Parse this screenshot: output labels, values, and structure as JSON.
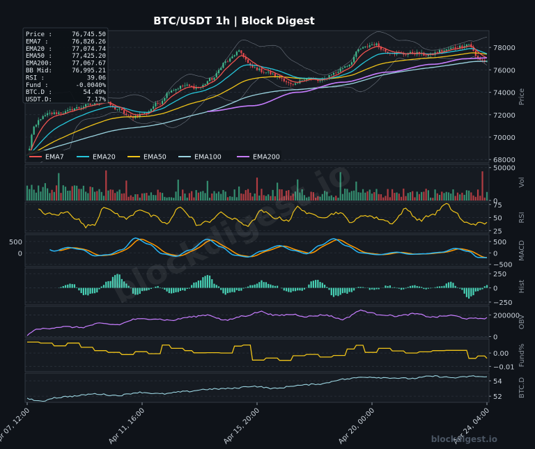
{
  "chart_data": {
    "type": "line",
    "title": "BTC/USDT  1h  |  Block Digest",
    "watermark": "blockdigest.io",
    "footer_brand": "blockdigest.io",
    "colors": {
      "background": "#0f1319",
      "panel": "#161b22",
      "grid": "#2a313b",
      "price_up": "#3fb68b",
      "price_down": "#e5484d",
      "ema7": "#ef5350",
      "ema20": "#26c6da",
      "ema50": "#f0c419",
      "ema100": "#9bd4e0",
      "ema200": "#c77dff",
      "rsi": "#f0c419",
      "macd": "#29b6f6",
      "signal": "#ff9800",
      "hist": "#48d1b5",
      "obv": "#c77dff",
      "funding": "#f0c419",
      "btcd": "#9bd4e0"
    },
    "x_ticks": [
      "Apr 07, 12:00",
      "Apr 11, 16:00",
      "Apr 15, 20:00",
      "Apr 20, 00:00",
      "Apr 24, 04:00"
    ],
    "info_box": [
      {
        "label": "Price  :",
        "value": "76,745.50"
      },
      {
        "label": "EMA7   :",
        "value": "76,826.26"
      },
      {
        "label": "EMA20  :",
        "value": "77,074.74"
      },
      {
        "label": "EMA50  :",
        "value": "77,425.20"
      },
      {
        "label": "EMA200:",
        "value": "77,067.67"
      },
      {
        "label": "BB Mid:",
        "value": "76,995.21"
      },
      {
        "label": "RSI    :",
        "value": "39.06"
      },
      {
        "label": "Fund   :",
        "value": "-0.0040%"
      },
      {
        "label": "BTC.D  :",
        "value": "54.49%"
      },
      {
        "label": "USDT.D:",
        "value": "7.17%"
      }
    ],
    "legend": [
      {
        "name": "EMA7",
        "color": "#ef5350"
      },
      {
        "name": "EMA20",
        "color": "#26c6da"
      },
      {
        "name": "EMA50",
        "color": "#f0c419"
      },
      {
        "name": "EMA100",
        "color": "#9bd4e0"
      },
      {
        "name": "EMA200",
        "color": "#c77dff"
      }
    ],
    "price_anchors": [
      [
        0,
        68400
      ],
      [
        3,
        70800
      ],
      [
        6,
        71700
      ],
      [
        10,
        72100
      ],
      [
        16,
        72200
      ],
      [
        22,
        72600
      ],
      [
        28,
        72900
      ],
      [
        34,
        73200
      ],
      [
        40,
        72500
      ],
      [
        46,
        71800
      ],
      [
        52,
        72100
      ],
      [
        58,
        73000
      ],
      [
        64,
        74200
      ],
      [
        70,
        74600
      ],
      [
        76,
        74400
      ],
      [
        82,
        75200
      ],
      [
        88,
        76700
      ],
      [
        94,
        77600
      ],
      [
        100,
        76200
      ],
      [
        106,
        75800
      ],
      [
        112,
        75300
      ],
      [
        118,
        74600
      ],
      [
        124,
        75300
      ],
      [
        130,
        75000
      ],
      [
        136,
        75700
      ],
      [
        142,
        76400
      ],
      [
        148,
        77900
      ],
      [
        154,
        78300
      ],
      [
        160,
        77600
      ],
      [
        166,
        77400
      ],
      [
        172,
        77500
      ],
      [
        178,
        77300
      ],
      [
        184,
        77700
      ],
      [
        190,
        78000
      ],
      [
        196,
        78300
      ],
      [
        200,
        77000
      ],
      [
        204,
        76750
      ]
    ],
    "ema200_anchors": [
      [
        80,
        72300
      ],
      [
        100,
        72800
      ],
      [
        120,
        74000
      ],
      [
        140,
        74900
      ],
      [
        160,
        75800
      ],
      [
        180,
        76500
      ],
      [
        195,
        77000
      ],
      [
        204,
        77070
      ]
    ],
    "rsi_anchors": [
      [
        0,
        74
      ],
      [
        4,
        66
      ],
      [
        8,
        58
      ],
      [
        12,
        55
      ],
      [
        18,
        60
      ],
      [
        22,
        48
      ],
      [
        26,
        33
      ],
      [
        30,
        38
      ],
      [
        34,
        72
      ],
      [
        38,
        60
      ],
      [
        44,
        48
      ],
      [
        50,
        66
      ],
      [
        56,
        52
      ],
      [
        62,
        38
      ],
      [
        68,
        72
      ],
      [
        72,
        52
      ],
      [
        76,
        35
      ],
      [
        80,
        42
      ],
      [
        86,
        58
      ],
      [
        92,
        46
      ],
      [
        98,
        35
      ],
      [
        104,
        62
      ],
      [
        110,
        50
      ],
      [
        116,
        45
      ],
      [
        120,
        70
      ],
      [
        126,
        55
      ],
      [
        132,
        52
      ],
      [
        138,
        60
      ],
      [
        144,
        42
      ],
      [
        150,
        55
      ],
      [
        156,
        48
      ],
      [
        162,
        40
      ],
      [
        168,
        66
      ],
      [
        174,
        45
      ],
      [
        180,
        56
      ],
      [
        186,
        75
      ],
      [
        190,
        60
      ],
      [
        194,
        40
      ],
      [
        198,
        38
      ],
      [
        204,
        39
      ]
    ],
    "macd_anchors": [
      [
        0,
        580
      ],
      [
        6,
        320
      ],
      [
        12,
        80
      ],
      [
        18,
        240
      ],
      [
        24,
        150
      ],
      [
        30,
        -130
      ],
      [
        36,
        -80
      ],
      [
        42,
        140
      ],
      [
        48,
        650
      ],
      [
        54,
        380
      ],
      [
        60,
        -40
      ],
      [
        66,
        -150
      ],
      [
        72,
        120
      ],
      [
        80,
        600
      ],
      [
        86,
        260
      ],
      [
        92,
        -100
      ],
      [
        98,
        -180
      ],
      [
        104,
        80
      ],
      [
        112,
        320
      ],
      [
        118,
        110
      ],
      [
        124,
        -40
      ],
      [
        130,
        330
      ],
      [
        136,
        620
      ],
      [
        142,
        300
      ],
      [
        148,
        0
      ],
      [
        156,
        -80
      ],
      [
        164,
        30
      ],
      [
        170,
        -60
      ],
      [
        176,
        -40
      ],
      [
        184,
        30
      ],
      [
        190,
        200
      ],
      [
        196,
        60
      ],
      [
        200,
        -200
      ],
      [
        204,
        -210
      ]
    ],
    "hist_anchors": [
      [
        0,
        0
      ],
      [
        4,
        -120
      ],
      [
        10,
        -60
      ],
      [
        16,
        30
      ],
      [
        20,
        70
      ],
      [
        26,
        -130
      ],
      [
        30,
        -80
      ],
      [
        36,
        110
      ],
      [
        40,
        260
      ],
      [
        44,
        80
      ],
      [
        48,
        -120
      ],
      [
        52,
        -60
      ],
      [
        58,
        30
      ],
      [
        64,
        -90
      ],
      [
        70,
        -40
      ],
      [
        76,
        120
      ],
      [
        80,
        240
      ],
      [
        84,
        40
      ],
      [
        88,
        -110
      ],
      [
        94,
        -50
      ],
      [
        100,
        40
      ],
      [
        104,
        120
      ],
      [
        110,
        40
      ],
      [
        116,
        -70
      ],
      [
        122,
        -40
      ],
      [
        128,
        150
      ],
      [
        132,
        60
      ],
      [
        136,
        -150
      ],
      [
        142,
        -90
      ],
      [
        148,
        20
      ],
      [
        154,
        -40
      ],
      [
        160,
        40
      ],
      [
        166,
        -30
      ],
      [
        172,
        40
      ],
      [
        178,
        -20
      ],
      [
        184,
        30
      ],
      [
        188,
        100
      ],
      [
        192,
        -20
      ],
      [
        196,
        -180
      ],
      [
        200,
        -60
      ],
      [
        204,
        40
      ]
    ],
    "obv_anchors": [
      [
        0,
        10000
      ],
      [
        3,
        60000
      ],
      [
        8,
        75000
      ],
      [
        16,
        90000
      ],
      [
        24,
        85000
      ],
      [
        32,
        120000
      ],
      [
        40,
        110000
      ],
      [
        48,
        160000
      ],
      [
        56,
        165000
      ],
      [
        64,
        150000
      ],
      [
        72,
        180000
      ],
      [
        80,
        200000
      ],
      [
        88,
        150000
      ],
      [
        96,
        190000
      ],
      [
        104,
        230000
      ],
      [
        110,
        195000
      ],
      [
        118,
        205000
      ],
      [
        124,
        185000
      ],
      [
        132,
        200000
      ],
      [
        140,
        160000
      ],
      [
        148,
        240000
      ],
      [
        156,
        205000
      ],
      [
        164,
        190000
      ],
      [
        172,
        210000
      ],
      [
        180,
        180000
      ],
      [
        188,
        195000
      ],
      [
        196,
        165000
      ],
      [
        204,
        170000
      ]
    ],
    "funding_steps": [
      [
        0,
        0.0082
      ],
      [
        6,
        0.0074
      ],
      [
        12,
        0.0054
      ],
      [
        18,
        0.0075
      ],
      [
        24,
        0.0043
      ],
      [
        30,
        0.0018
      ],
      [
        36,
        0.0005
      ],
      [
        42,
        -0.0011
      ],
      [
        48,
        0.001
      ],
      [
        54,
        -0.0005
      ],
      [
        60,
        0.006
      ],
      [
        64,
        0.0035
      ],
      [
        70,
        0.0018
      ],
      [
        74,
        0.0002
      ],
      [
        80,
        0.0003
      ],
      [
        86,
        0.0
      ],
      [
        92,
        0.0052
      ],
      [
        96,
        0.006
      ],
      [
        100,
        -0.0053
      ],
      [
        106,
        -0.0038
      ],
      [
        112,
        -0.0055
      ],
      [
        118,
        -0.002
      ],
      [
        124,
        -0.001
      ],
      [
        130,
        -0.003
      ],
      [
        136,
        -0.0018
      ],
      [
        142,
        0.003
      ],
      [
        146,
        0.0058
      ],
      [
        150,
        0.0005
      ],
      [
        156,
        0.0035
      ],
      [
        162,
        0.0016
      ],
      [
        168,
        0.0
      ],
      [
        174,
        0.0009
      ],
      [
        180,
        0.0018
      ],
      [
        186,
        0.002
      ],
      [
        192,
        0.002
      ],
      [
        196,
        -0.004
      ],
      [
        200,
        -0.0022
      ],
      [
        204,
        -0.004
      ]
    ],
    "btcd_anchors": [
      [
        0,
        51.7
      ],
      [
        6,
        51.3
      ],
      [
        12,
        51.8
      ],
      [
        20,
        52.0
      ],
      [
        30,
        52.3
      ],
      [
        40,
        52.1
      ],
      [
        50,
        52.5
      ],
      [
        60,
        52.3
      ],
      [
        70,
        52.6
      ],
      [
        80,
        52.9
      ],
      [
        90,
        53.0
      ],
      [
        100,
        53.3
      ],
      [
        110,
        53.0
      ],
      [
        120,
        53.4
      ],
      [
        130,
        53.6
      ],
      [
        140,
        54.2
      ],
      [
        150,
        54.5
      ],
      [
        160,
        54.4
      ],
      [
        170,
        54.3
      ],
      [
        180,
        54.6
      ],
      [
        190,
        54.4
      ],
      [
        198,
        54.6
      ],
      [
        204,
        54.49
      ]
    ],
    "panels": [
      {
        "key": "price",
        "ylabel": "Price",
        "ylim": [
          67700,
          79500
        ],
        "ticks": [
          68000,
          70000,
          72000,
          74000,
          76000,
          78000
        ],
        "tick_labels": [
          "68000",
          "70000",
          "72000",
          "74000",
          "76000",
          "78000"
        ]
      },
      {
        "key": "vol",
        "ylabel": "Vol",
        "ylim": [
          0,
          55000
        ],
        "ticks": [
          0,
          50000
        ],
        "tick_labels": [
          "0",
          "50000"
        ]
      },
      {
        "key": "rsi",
        "ylabel": "RSI",
        "ylim": [
          20,
          80
        ],
        "ticks": [
          25,
          50,
          75
        ],
        "tick_labels": [
          "25",
          "50",
          "75"
        ]
      },
      {
        "key": "macd",
        "ylabel": "MACD",
        "ylim": [
          -600,
          800
        ],
        "ticks": [
          -500,
          0,
          500
        ],
        "tick_labels": [
          "−500",
          "0",
          "500"
        ],
        "left_ticks": [
          0,
          500
        ],
        "left_tick_labels": [
          "0",
          "500"
        ]
      },
      {
        "key": "hist",
        "ylabel": "Hist",
        "ylim": [
          -300,
          350
        ],
        "ticks": [
          -250,
          0,
          250
        ],
        "tick_labels": [
          "−250",
          "0",
          "250"
        ]
      },
      {
        "key": "obv",
        "ylabel": "OBV",
        "ylim": [
          -10000,
          280000
        ],
        "ticks": [
          0,
          200000
        ],
        "tick_labels": [
          "0",
          "200000"
        ]
      },
      {
        "key": "fund",
        "ylabel": "Fund%",
        "ylim": [
          -0.014,
          0.0105
        ],
        "ticks": [
          -0.01,
          0.0
        ],
        "tick_labels": [
          "−0.01",
          "0.00"
        ]
      },
      {
        "key": "btcd",
        "ylabel": "BTC.D",
        "ylim": [
          51.2,
          55.0
        ],
        "ticks": [
          52,
          54
        ],
        "tick_labels": [
          "52",
          "54"
        ]
      }
    ]
  }
}
